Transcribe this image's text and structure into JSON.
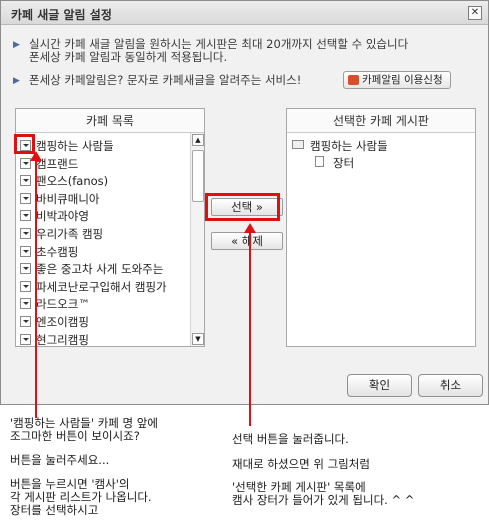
{
  "dialog": {
    "title": "카페 새글 알림 설정",
    "close_glyph": "✕",
    "info_line1a": "실시간 카페 새글 알림을 원하시는 게시판은 최대 20개까지 선택할 수 있습니다",
    "info_line1b": "폰세상 카페 알림과 동일하게 적용됩니다.",
    "info_line2": "폰세상 카페알림은? 문자로 카페새글을 알려주는 서비스!",
    "apply_label": "카페알림 이용신청",
    "left_panel_title": "카페 목록",
    "right_panel_title": "선택한 카페 게시판",
    "cafe_list": [
      "캠핑하는 사람들",
      "캠프랜드",
      "팬오스(fanos)",
      "바비큐매니아",
      "비박과야영",
      "우리가족 캠핑",
      "초수캠핑",
      "좋은 중고차 사게 도와주는",
      "파세코난로구입해서 캠핑가",
      "라드오크™",
      "엔조이캠핑",
      "현그리캠핑"
    ],
    "select_label": "선택 »",
    "remove_label": "« 해제",
    "selected_cafe": "캠핑하는 사람들",
    "selected_board": "장터",
    "confirm_label": "확인",
    "cancel_label": "취소"
  },
  "annotations": {
    "left_note": [
      "'캠핑하는 사람들' 카페 명 앞에",
      "조그마한 버튼이 보이시죠?",
      "버튼을 눌러주세요...",
      "버튼을 누르시면 '캠사'의",
      "각 게시판 리스트가 나옵니다.",
      "장터를 선택하시고"
    ],
    "right_note": [
      "선택 버튼을 눌러줍니다.",
      "재대로 하셨으면 위 그림처럼",
      "'선택한 카페 게시판' 목록에",
      "캠사 장터가 들어가 있게 됩니다. ^ ^"
    ],
    "highlight_color": "#e01010"
  }
}
